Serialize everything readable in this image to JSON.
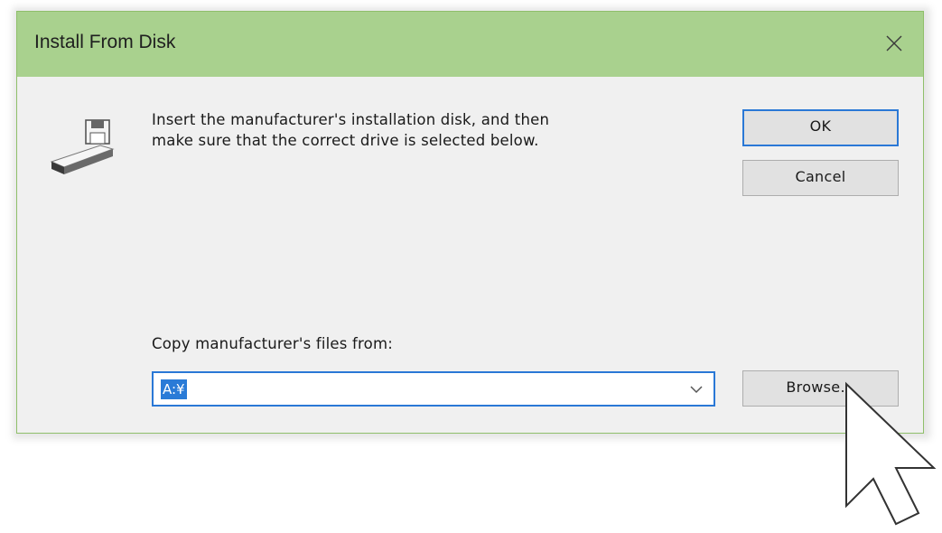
{
  "dialog": {
    "title": "Install From Disk",
    "message": "Insert the manufacturer's installation disk, and then\nmake sure that the correct drive is selected below.",
    "ok_label": "OK",
    "cancel_label": "Cancel",
    "copy_label": "Copy manufacturer's files from:",
    "path_value": "A:¥",
    "browse_label": "Browse..."
  },
  "icons": {
    "close": "close-icon",
    "disk": "floppy-disk-drive-icon",
    "dropdown": "chevron-down-icon",
    "cursor": "mouse-pointer-icon"
  },
  "colors": {
    "titlebar": "#a9d18e",
    "focus_border": "#2a78d6",
    "selection": "#2a7bd7"
  }
}
